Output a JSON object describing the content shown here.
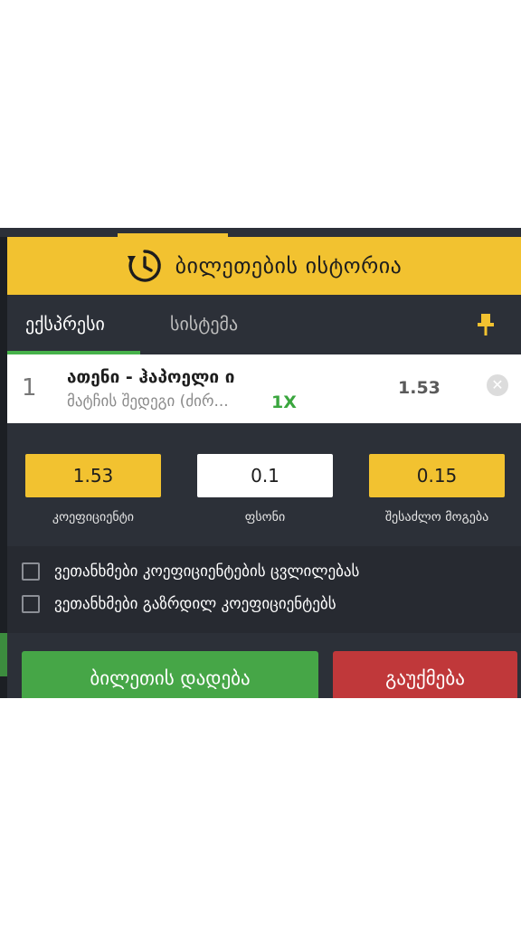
{
  "header": {
    "title": "ბილეთების ისტორია",
    "icon": "history-icon"
  },
  "tabs": [
    {
      "label": "ექსპრესი",
      "active": true
    },
    {
      "label": "სისტემა",
      "active": false
    }
  ],
  "bet": {
    "index": "1",
    "match": "ათენი - ჰაპოელი ი",
    "market": "მატჩის შედეგი (ძირ...",
    "pick": "1X",
    "odd": "1.53"
  },
  "summary": {
    "coefficient": {
      "value": "1.53",
      "label": "კოეფიციენტი"
    },
    "stake": {
      "value": "0.1",
      "label": "ფსონი"
    },
    "potential_win": {
      "value": "0.15",
      "label": "შესაძლო მოგება"
    }
  },
  "options": [
    {
      "label": "ვეთანხმები კოეფიციენტების ცვლილებას",
      "checked": false
    },
    {
      "label": "ვეთანხმები გაზრდილ კოეფიციენტებს",
      "checked": false
    }
  ],
  "actions": {
    "place": "ბილეთის დადება",
    "cancel": "გაუქმება"
  },
  "colors": {
    "accent": "#f2c230",
    "green": "#46a647",
    "red": "#c0383a",
    "panel": "#2c3038"
  }
}
